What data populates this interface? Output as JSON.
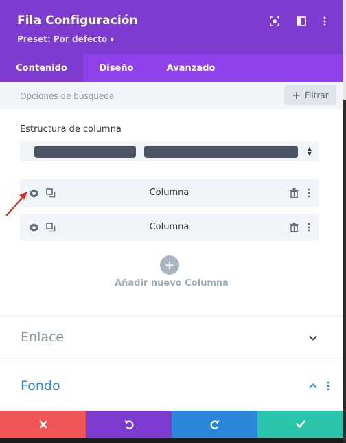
{
  "header": {
    "title": "Fila Configuración",
    "preset": "Preset: Por defecto",
    "icons": [
      "screenshot-icon",
      "split-view-icon",
      "more-vertical-icon"
    ],
    "background": "#7e3bd0"
  },
  "tabs": [
    {
      "label": "Contenido",
      "active": true
    },
    {
      "label": "Diseño",
      "active": false
    },
    {
      "label": "Avanzado",
      "active": false
    }
  ],
  "search": {
    "placeholder": "Opciones de búsqueda",
    "filter_label": "Filtrar"
  },
  "structure": {
    "label": "Estructura de columna"
  },
  "columns": [
    {
      "label": "Columna"
    },
    {
      "label": "Columna"
    }
  ],
  "add_column": {
    "label": "Añadir nuevo Columna"
  },
  "sections": [
    {
      "title": "Enlace",
      "expanded": false,
      "color": "#8b95a1"
    },
    {
      "title": "Fondo",
      "expanded": true,
      "color": "#2b87da"
    }
  ],
  "footer": {
    "buttons": [
      {
        "name": "cancel",
        "color": "#ef5555"
      },
      {
        "name": "undo",
        "color": "#7e3bd0"
      },
      {
        "name": "redo",
        "color": "#2b87da"
      },
      {
        "name": "save",
        "color": "#29c4a9"
      }
    ]
  },
  "colors": {
    "tabs_bg": "#8f42ec",
    "active_tab_bg": "#7e3bd0",
    "annotation_arrow": "#e02b20"
  }
}
